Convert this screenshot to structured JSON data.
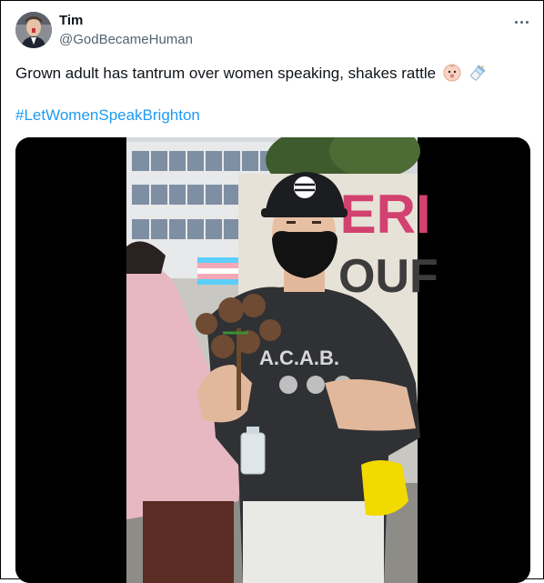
{
  "tweet": {
    "author_name": "Tim",
    "author_handle": "@GodBecameHuman",
    "text": "Grown adult has tantrum over women speaking, shakes rattle",
    "emojis": [
      "baby-face-icon",
      "baby-bottle-icon"
    ],
    "hashtag": "#LetWomenSpeakBrighton"
  },
  "media": {
    "type": "video",
    "sign_text_top": "TERI",
    "sign_text_mid": "OUF",
    "cap_logo": "stripes",
    "shirt_text": "A.C.A.B.",
    "trans_flag_colors": [
      "#5bcefa",
      "#f5a9b8",
      "#ffffff",
      "#f5a9b8",
      "#5bcefa"
    ]
  }
}
